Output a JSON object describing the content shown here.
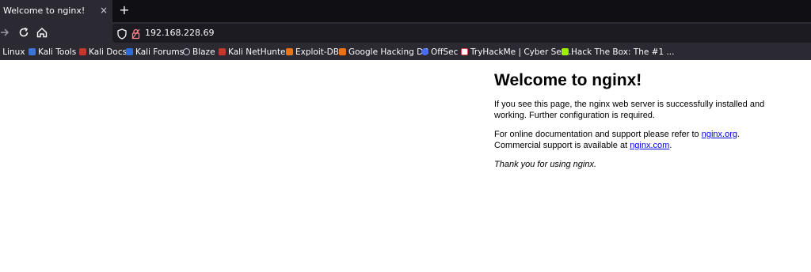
{
  "browser": {
    "tab": {
      "title": "Welcome to nginx!",
      "close_glyph": "×"
    },
    "new_tab_glyph": "+",
    "url": "192.168.228.69",
    "bookmarks": [
      {
        "label": "i Linux",
        "icon": "kali-icon",
        "color": "#2f6bd8"
      },
      {
        "label": "Kali Tools",
        "icon": "kali-tools-icon",
        "color": "#3b73d9"
      },
      {
        "label": "Kali Docs",
        "icon": "kali-docs-icon",
        "color": "#c0392b"
      },
      {
        "label": "Kali Forums",
        "icon": "kali-forums-icon",
        "color": "#2f6bd8"
      },
      {
        "label": "Blaze",
        "icon": "globe-icon",
        "color": "#cfcfd8"
      },
      {
        "label": "Kali NetHunter",
        "icon": "nethunter-icon",
        "color": "#c0392b"
      },
      {
        "label": "Exploit-DB",
        "icon": "exploit-db-icon",
        "color": "#e8741a"
      },
      {
        "label": "Google Hacking DB",
        "icon": "ghdb-icon",
        "color": "#e8741a"
      },
      {
        "label": "OffSec",
        "icon": "offsec-icon",
        "color": "#4a6cf7"
      },
      {
        "label": "TryHackMe | Cyber Sec...",
        "icon": "tryhackme-icon",
        "color": "#e04646"
      },
      {
        "label": "Hack The Box: The #1 ...",
        "icon": "htb-icon",
        "color": "#9fef00"
      }
    ]
  },
  "page": {
    "heading": "Welcome to nginx!",
    "p1": "If you see this page, the nginx web server is successfully installed and working. Further configuration is required.",
    "p2_before": "For online documentation and support please refer to ",
    "p2_link1": "nginx.org",
    "p2_mid": ".",
    "p2_after": "Commercial support is available at ",
    "p2_link2": "nginx.com",
    "p2_end": ".",
    "p3": "Thank you for using nginx."
  }
}
